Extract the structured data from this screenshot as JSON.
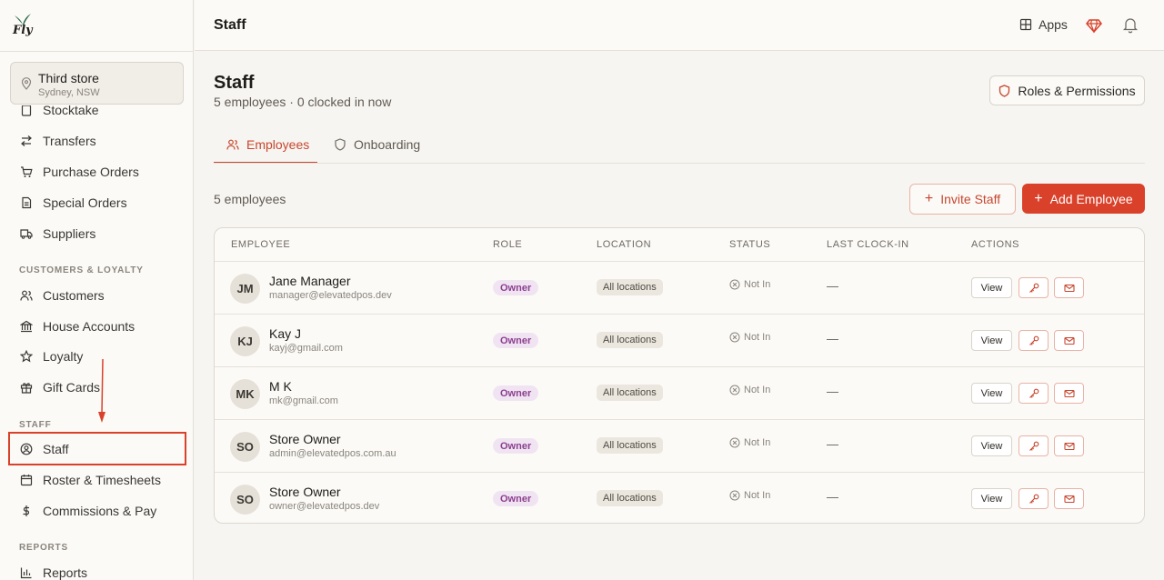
{
  "brand": {
    "logo_text": "Fly"
  },
  "store": {
    "name": "Third store",
    "location": "Sydney, NSW"
  },
  "sidebar": {
    "items": [
      {
        "label": "Stocktake",
        "icon": "clipboard-icon"
      },
      {
        "label": "Transfers",
        "icon": "transfer-arrows-icon"
      },
      {
        "label": "Purchase Orders",
        "icon": "cart-icon"
      },
      {
        "label": "Special Orders",
        "icon": "document-icon"
      },
      {
        "label": "Suppliers",
        "icon": "truck-icon"
      },
      {
        "label": "Customers",
        "icon": "users-icon"
      },
      {
        "label": "House Accounts",
        "icon": "bank-icon"
      },
      {
        "label": "Loyalty",
        "icon": "star-icon"
      },
      {
        "label": "Gift Cards",
        "icon": "gift-icon"
      },
      {
        "label": "Staff",
        "icon": "user-circle-icon"
      },
      {
        "label": "Roster & Timesheets",
        "icon": "calendar-icon"
      },
      {
        "label": "Commissions & Pay",
        "icon": "dollar-icon"
      },
      {
        "label": "Reports",
        "icon": "bar-chart-icon"
      }
    ],
    "sections": {
      "customers": "CUSTOMERS & LOYALTY",
      "staff": "STAFF",
      "reports": "REPORTS"
    }
  },
  "header": {
    "title": "Staff",
    "apps_label": "Apps"
  },
  "page": {
    "title": "Staff",
    "subtitle": "5 employees · 0 clocked in now",
    "roles_button": "Roles & Permissions",
    "tabs": [
      {
        "label": "Employees",
        "icon": "users-icon",
        "active": true
      },
      {
        "label": "Onboarding",
        "icon": "shield-icon",
        "active": false
      }
    ],
    "count_text": "5 employees",
    "invite_button": "Invite Staff",
    "add_button": "Add Employee"
  },
  "table": {
    "columns": [
      "EMPLOYEE",
      "ROLE",
      "LOCATION",
      "STATUS",
      "LAST CLOCK-IN",
      "ACTIONS"
    ],
    "rows": [
      {
        "initials": "JM",
        "name": "Jane Manager",
        "email": "manager@elevatedpos.dev",
        "role": "Owner",
        "location": "All locations",
        "status": "Not In",
        "last_clock_in": "—",
        "view": "View"
      },
      {
        "initials": "KJ",
        "name": "Kay J",
        "email": "kayj@gmail.com",
        "role": "Owner",
        "location": "All locations",
        "status": "Not In",
        "last_clock_in": "—",
        "view": "View"
      },
      {
        "initials": "MK",
        "name": "M K",
        "email": "mk@gmail.com",
        "role": "Owner",
        "location": "All locations",
        "status": "Not In",
        "last_clock_in": "—",
        "view": "View"
      },
      {
        "initials": "SO",
        "name": "Store Owner",
        "email": "admin@elevatedpos.com.au",
        "role": "Owner",
        "location": "All locations",
        "status": "Not In",
        "last_clock_in": "—",
        "view": "View"
      },
      {
        "initials": "SO",
        "name": "Store Owner",
        "email": "owner@elevatedpos.dev",
        "role": "Owner",
        "location": "All locations",
        "status": "Not In",
        "last_clock_in": "—",
        "view": "View"
      }
    ]
  },
  "colors": {
    "accent": "#d9412a",
    "accent_text": "#c8472f",
    "annotation": "#d9412a",
    "role_badge_bg": "#f1e4f2",
    "role_badge_text": "#8b3f8f"
  }
}
